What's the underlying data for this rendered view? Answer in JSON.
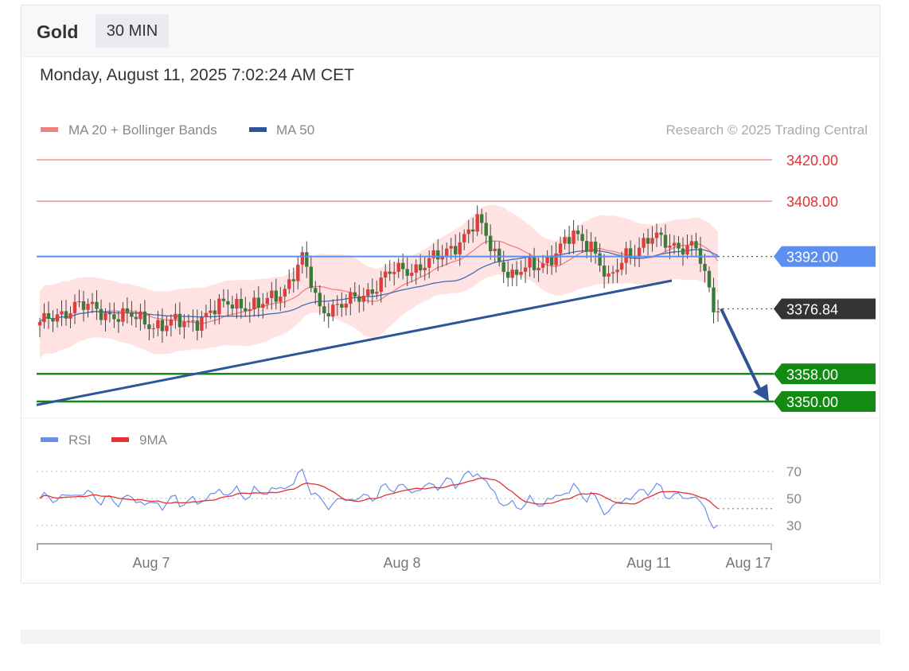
{
  "header": {
    "symbol": "Gold",
    "interval": "30 MIN",
    "datetime": "Monday, August 11, 2025 7:02:24 AM CET"
  },
  "legend": {
    "ma20_label": "MA 20 + Bollinger Bands",
    "ma50_label": "MA 50",
    "credit": "Research © 2025 Trading Central",
    "rsi_label": "RSI",
    "rsi_ma_label": "9MA"
  },
  "colors": {
    "bull": "#e03c3c",
    "bear": "#3a7a3a",
    "band": "#ffd9d9",
    "ma20": "#f08080",
    "ma50": "#3f6fb7",
    "trend": "#2e5597",
    "resistance": "#f4a3a3",
    "pivot": "#5b8ff0",
    "support": "#138a13",
    "rsi": "#6a8ee8",
    "rsi_ma": "#e23232"
  },
  "chart_data": [
    {
      "type": "line",
      "title": "",
      "ylim": [
        3348,
        3422
      ],
      "x_tick_labels": [
        "Aug 7",
        "Aug 8",
        "Aug 11",
        "Aug 17"
      ],
      "levels": [
        {
          "value": 3420.0,
          "label": "3420.00",
          "kind": "resistance"
        },
        {
          "value": 3408.0,
          "label": "3408.00",
          "kind": "resistance"
        },
        {
          "value": 3392.0,
          "label": "3392.00",
          "kind": "pivot"
        },
        {
          "value": 3376.84,
          "label": "3376.84",
          "kind": "last"
        },
        {
          "value": 3358.0,
          "label": "3358.00",
          "kind": "support"
        },
        {
          "value": 3350.0,
          "label": "3350.00",
          "kind": "support"
        }
      ],
      "trendline": {
        "from": 3349,
        "to": 3385
      },
      "forecast_arrow": {
        "from": 3376.84,
        "to": 3350
      },
      "series": [
        {
          "name": "MA 20 + Bollinger Bands"
        },
        {
          "name": "MA 50"
        }
      ]
    },
    {
      "type": "line",
      "ylim": [
        30,
        70
      ],
      "y_ticks": [
        70,
        50,
        30
      ],
      "series": [
        {
          "name": "RSI"
        },
        {
          "name": "9MA"
        }
      ]
    }
  ]
}
